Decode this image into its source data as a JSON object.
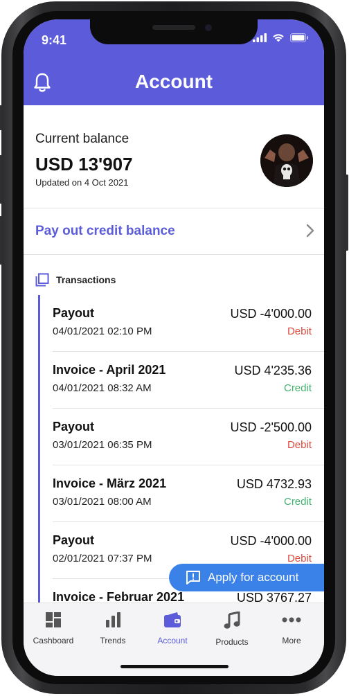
{
  "status": {
    "time": "9:41"
  },
  "header": {
    "title": "Account"
  },
  "balance": {
    "label": "Current balance",
    "amount": "USD 13'907",
    "updated": "Updated on 4 Oct 2021"
  },
  "payout": {
    "label": "Pay out credit balance"
  },
  "transactions": {
    "title": "Transactions",
    "items": [
      {
        "name": "Payout",
        "date": "04/01/2021 02:10 PM",
        "amount": "USD -4'000.00",
        "type": "Debit"
      },
      {
        "name": "Invoice - April 2021",
        "date": "04/01/2021 08:32 AM",
        "amount": "USD 4'235.36",
        "type": "Credit"
      },
      {
        "name": "Payout",
        "date": "03/01/2021 06:35 PM",
        "amount": "USD -2'500.00",
        "type": "Debit"
      },
      {
        "name": "Invoice - März 2021",
        "date": "03/01/2021 08:00 AM",
        "amount": "USD 4732.93",
        "type": "Credit"
      },
      {
        "name": "Payout",
        "date": "02/01/2021 07:37 PM",
        "amount": "USD -4'000.00",
        "type": "Debit"
      },
      {
        "name": "Invoice - Februar 2021",
        "date": "",
        "amount": "USD 3767.27",
        "type": ""
      }
    ]
  },
  "apply_button": {
    "label": "Apply for account"
  },
  "tabs": [
    {
      "label": "Cashboard",
      "icon": "dashboard-icon"
    },
    {
      "label": "Trends",
      "icon": "bar-chart-icon"
    },
    {
      "label": "Account",
      "icon": "wallet-icon",
      "active": true
    },
    {
      "label": "Products",
      "icon": "music-note-icon"
    },
    {
      "label": "More",
      "icon": "more-dots-icon"
    }
  ],
  "colors": {
    "primary": "#5c5cdb",
    "debit": "#e04a3e",
    "credit": "#3fb16d",
    "apply_button": "#3b82e8"
  }
}
